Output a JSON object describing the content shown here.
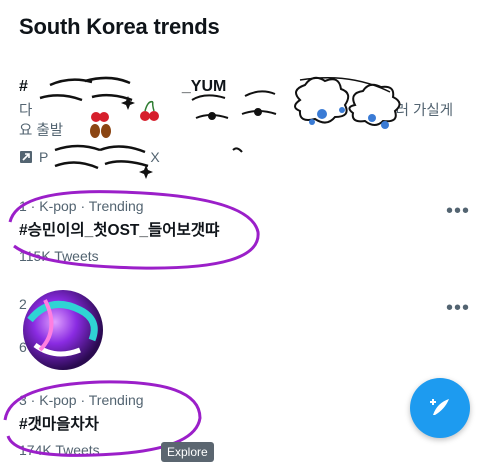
{
  "header": {
    "title": "South Korea trends"
  },
  "promoted": {
    "hashtag_prefix": "#",
    "hashtag_suffix": "_YUM",
    "desc_line1_start": "다",
    "desc_line1_mid": "을 갱",
    "desc_line1_end": "으러 가실게",
    "desc_line2": "요 출발",
    "promoted_by": "P",
    "promoted_tail": "X"
  },
  "trends": [
    {
      "meta": "1 · K-pop · Trending",
      "title": "#승민이의_첫OST_들어보갯땨",
      "count": "115K Tweets"
    },
    {
      "meta_prefix": "2",
      "count_prefix": "6"
    },
    {
      "meta": "3 · K-pop · Trending",
      "title": "#갯마을차차",
      "count": "174K Tweets"
    }
  ],
  "tooltip": {
    "label": "Explore"
  },
  "more_glyph": "•••",
  "icons": [
    "promoted-arrow-icon",
    "compose-tweet-icon",
    "more-icon"
  ],
  "colors": {
    "accent": "#1d9bf0",
    "annotation": "#9b1fc9",
    "secondary_text": "#536471"
  }
}
